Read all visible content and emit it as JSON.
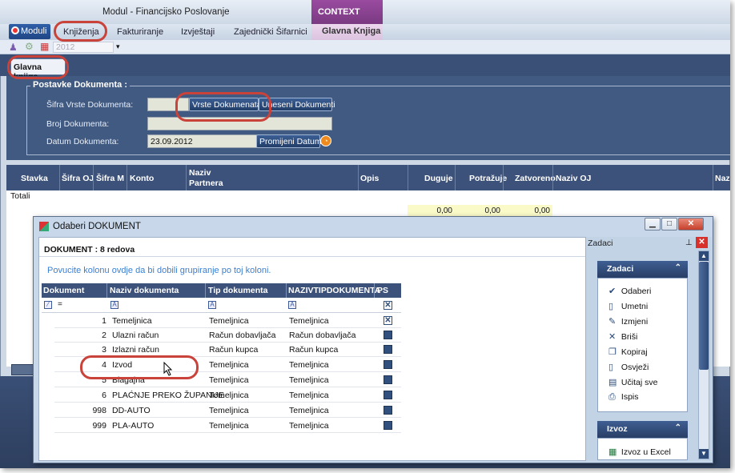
{
  "app": {
    "title": "Modul - Financijsko Poslovanje",
    "context_header": "CONTEXT",
    "year": "2012",
    "tabs": [
      {
        "label": "Moduli"
      },
      {
        "label": "Knjiženja"
      },
      {
        "label": "Fakturiranje"
      },
      {
        "label": "Izvještaji"
      },
      {
        "label": "Zajednički Šifarnici"
      }
    ],
    "context_tab": "Glavna Knjiga",
    "sub_tab": "Glavna knjiga"
  },
  "form": {
    "group_title": "Postavke Dokumenta :",
    "sifra_label": "Šifra Vrste Dokumenta:",
    "broj_label": "Broj Dokumenta:",
    "datum_label": "Datum Dokumenta:",
    "datum_value": "23.09.2012",
    "btn_vrste": "Vrste Dokumenata",
    "btn_uneseni": "Uneseni Dokumenti",
    "btn_promijeni": "Promijeni Datum"
  },
  "grid": {
    "columns": [
      "Stavka",
      "Šifra OJ",
      "Šifra M",
      "Konto",
      "Naziv",
      "Partnera",
      "Opis",
      "Duguje",
      "Potražuje",
      "Zatvoreno",
      "Naziv OJ",
      "Naz"
    ],
    "totals_label": "Totali",
    "totals": {
      "duguje": "0,00",
      "potrazuje": "0,00",
      "zatvoreno": "0,00"
    }
  },
  "dialog": {
    "title": "Odaberi DOKUMENT",
    "count": "DOKUMENT : 8 redova",
    "group_hint": "Povucite kolonu ovdje da bi dobili grupiranje po toj koloni.",
    "columns": [
      "Dokument",
      "Naziv dokumenta",
      "Tip dokumenta",
      "NAZIVTIPDOKUMENTA",
      "PS"
    ],
    "filter_eq": "=",
    "rows": [
      {
        "id": "1",
        "naziv": "Temeljnica",
        "tip": "Temeljnica",
        "naziv_tip": "Temeljnica",
        "ps": "x"
      },
      {
        "id": "2",
        "naziv": "Ulazni račun",
        "tip": "Račun dobavljača",
        "naziv_tip": "Račun dobavljača",
        "ps": ""
      },
      {
        "id": "3",
        "naziv": "Izlazni račun",
        "tip": "Račun kupca",
        "naziv_tip": "Račun kupca",
        "ps": ""
      },
      {
        "id": "4",
        "naziv": "Izvod",
        "tip": "Temeljnica",
        "naziv_tip": "Temeljnica",
        "ps": ""
      },
      {
        "id": "5",
        "naziv": "Blagajna",
        "tip": "Temeljnica",
        "naziv_tip": "Temeljnica",
        "ps": ""
      },
      {
        "id": "6",
        "naziv": "PLAĆNJE PREKO ŽUPANIJE",
        "tip": "Temeljnica",
        "naziv_tip": "Temeljnica",
        "ps": ""
      },
      {
        "id": "998",
        "naziv": "DD-AUTO",
        "tip": "Temeljnica",
        "naziv_tip": "Temeljnica",
        "ps": ""
      },
      {
        "id": "999",
        "naziv": "PLA-AUTO",
        "tip": "Temeljnica",
        "naziv_tip": "Temeljnica",
        "ps": ""
      }
    ]
  },
  "tasks": {
    "pane_title": "Zadaci",
    "panel1_title": "Zadaci",
    "items": [
      "Odaberi",
      "Umetni",
      "Izmjeni",
      "Briši",
      "Kopiraj",
      "Osvježi",
      "Učitaj sve",
      "Ispis"
    ],
    "panel2_title": "Izvoz",
    "export_item": "Izvoz u Excel"
  },
  "icons": [
    "check-icon",
    "new-doc-icon",
    "edit-icon",
    "delete-icon",
    "copy-icon",
    "refresh-icon",
    "load-all-icon",
    "print-icon",
    "excel-icon"
  ],
  "colors": {
    "navy": "#3d527a",
    "context": "#7a3a82",
    "annotation": "#c9433b",
    "accent_orange": "#f08a1d"
  }
}
